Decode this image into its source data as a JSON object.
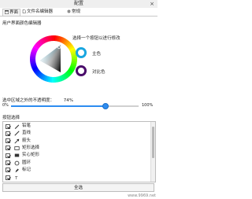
{
  "window": {
    "title": "配置",
    "close_label": "×"
  },
  "tabs": [
    {
      "label": "界面",
      "active": true,
      "icon": "interface-icon"
    },
    {
      "label": "文件名编辑器",
      "active": false,
      "icon": "document-icon"
    },
    {
      "label": "常规",
      "active": false,
      "icon": "settings-icon"
    }
  ],
  "color_editor": {
    "heading": "用户界面颜色编辑器",
    "hint": "选择一个按钮以进行修改",
    "main_color": {
      "label": "主色",
      "color": "#19a6e0"
    },
    "contrast_color": {
      "label": "对比色",
      "color": "#4a0d6b"
    }
  },
  "opacity": {
    "label": "选中区域之外的不透明度：",
    "value": "74%",
    "fraction": 0.74,
    "min_label": "0%",
    "max_label": "100%"
  },
  "buttons": {
    "heading": "按钮选择",
    "items": [
      {
        "label": "铅笔",
        "checked": true,
        "icon": "pencil-icon"
      },
      {
        "label": "直线",
        "checked": true,
        "icon": "line-icon"
      },
      {
        "label": "箭头",
        "checked": true,
        "icon": "arrow-icon"
      },
      {
        "label": "矩形选择",
        "checked": true,
        "icon": "rectangle-selection-icon"
      },
      {
        "label": "实心矩形",
        "checked": true,
        "icon": "filled-rectangle-icon"
      },
      {
        "label": "圆环",
        "checked": true,
        "icon": "circle-icon"
      },
      {
        "label": "标记",
        "checked": true,
        "icon": "marker-icon"
      },
      {
        "label": "",
        "checked": true,
        "icon": "text-icon"
      }
    ],
    "select_all_label": "全选"
  },
  "watermark": "www.9969.net"
}
